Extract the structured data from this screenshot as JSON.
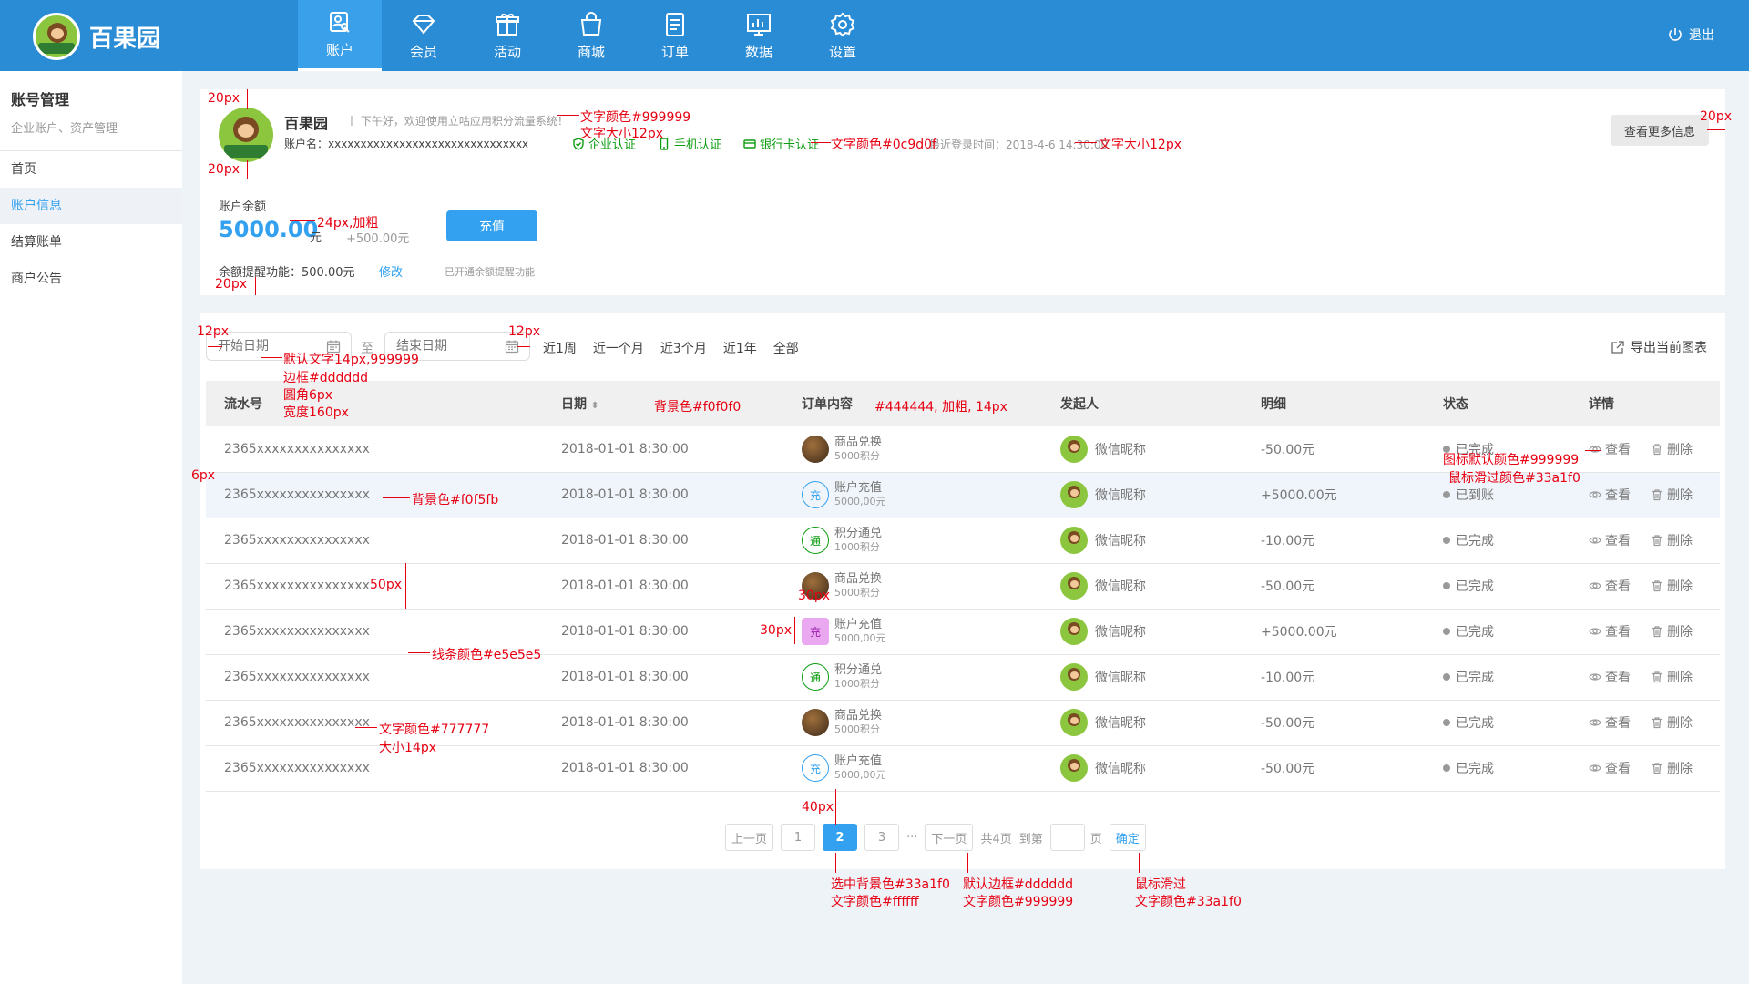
{
  "app": {
    "name": "百果园"
  },
  "nav": [
    {
      "label": "账户",
      "icon": "account-icon"
    },
    {
      "label": "会员",
      "icon": "diamond-icon"
    },
    {
      "label": "活动",
      "icon": "gift-icon"
    },
    {
      "label": "商城",
      "icon": "bag-icon"
    },
    {
      "label": "订单",
      "icon": "order-icon"
    },
    {
      "label": "数据",
      "icon": "chart-icon"
    },
    {
      "label": "设置",
      "icon": "gear-icon"
    }
  ],
  "logout": "退出",
  "sidebar": {
    "title": "账号管理",
    "subtitle": "企业账户、资产管理",
    "items": [
      {
        "label": "首页"
      },
      {
        "label": "账户信息",
        "active": true
      },
      {
        "label": "结算账单"
      },
      {
        "label": "商户公告"
      }
    ]
  },
  "account": {
    "name": "百果园",
    "greeting": "丨 下午好，欢迎使用立咕应用积分流量系统！",
    "account_label": "账户名：xxxxxxxxxxxxxxxxxxxxxxxxxxxxxxx",
    "certs": [
      "企业认证",
      "手机认证",
      "银行卡认证"
    ],
    "last_login": "最近登录时间：2018-4-6 14:30:00",
    "more_button": "查看更多信息",
    "balance_label": "账户余额",
    "balance": "5000.00",
    "balance_unit": "元",
    "balance_extra": "+500.00元",
    "recharge_button": "充值",
    "remind": "余额提醒功能：500.00元",
    "modify": "修改",
    "remind_note": "已开通余额提醒功能"
  },
  "filter": {
    "start_placeholder": "开始日期",
    "end_placeholder": "结束日期",
    "to": "至",
    "ranges": [
      "近1周",
      "近一个月",
      "近3个月",
      "近1年",
      "全部"
    ],
    "export": "导出当前图表"
  },
  "table": {
    "headers": [
      "流水号",
      "日期",
      "订单内容",
      "发起人",
      "明细",
      "状态",
      "详情"
    ],
    "rows": [
      {
        "serial": "2365xxxxxxxxxxxxxxx",
        "date": "2018-01-01 8:30:00",
        "icon": "img",
        "icon_text": "",
        "title": "商品兑换",
        "sub": "5000积分",
        "user": "微信昵称",
        "amount": "-50.00元",
        "status": "已完成"
      },
      {
        "serial": "2365xxxxxxxxxxxxxxx",
        "date": "2018-01-01 8:30:00",
        "icon": "blue",
        "icon_text": "充",
        "title": "账户充值",
        "sub": "5000,00元",
        "user": "微信昵称",
        "amount": "+5000.00元",
        "status": "已到账"
      },
      {
        "serial": "2365xxxxxxxxxxxxxxx",
        "date": "2018-01-01 8:30:00",
        "icon": "green",
        "icon_text": "通",
        "title": "积分通兑",
        "sub": "1000积分",
        "user": "微信昵称",
        "amount": "-10.00元",
        "status": "已完成"
      },
      {
        "serial": "2365xxxxxxxxxxxxxxx",
        "date": "2018-01-01 8:30:00",
        "icon": "img",
        "icon_text": "",
        "title": "商品兑换",
        "sub": "5000积分",
        "user": "微信昵称",
        "amount": "-50.00元",
        "status": "已完成"
      },
      {
        "serial": "2365xxxxxxxxxxxxxxx",
        "date": "2018-01-01 8:30:00",
        "icon": "pink",
        "icon_text": "充",
        "title": "账户充值",
        "sub": "5000,00元",
        "user": "微信昵称",
        "amount": "+5000.00元",
        "status": "已完成"
      },
      {
        "serial": "2365xxxxxxxxxxxxxxx",
        "date": "2018-01-01 8:30:00",
        "icon": "green",
        "icon_text": "通",
        "title": "积分通兑",
        "sub": "1000积分",
        "user": "微信昵称",
        "amount": "-10.00元",
        "status": "已完成"
      },
      {
        "serial": "2365xxxxxxxxxxxxxxx",
        "date": "2018-01-01 8:30:00",
        "icon": "img",
        "icon_text": "",
        "title": "商品兑换",
        "sub": "5000积分",
        "user": "微信昵称",
        "amount": "-50.00元",
        "status": "已完成"
      },
      {
        "serial": "2365xxxxxxxxxxxxxxx",
        "date": "2018-01-01 8:30:00",
        "icon": "blue",
        "icon_text": "充",
        "title": "账户充值",
        "sub": "5000,00元",
        "user": "微信昵称",
        "amount": "-50.00元",
        "status": "已完成"
      }
    ],
    "view": "查看",
    "delete": "删除"
  },
  "pager": {
    "prev": "上一页",
    "pages": [
      "1",
      "2",
      "3"
    ],
    "current": "2",
    "ellipsis": "···",
    "next": "下一页",
    "total": "共4页",
    "goto": "到第",
    "page_unit": "页",
    "confirm": "确定"
  },
  "annotations": [
    "20px",
    "20px",
    "文字颜色#999999",
    "文字大小12px",
    "文字颜色#0c9d0f",
    "文字大小12px",
    "20px",
    "24px,加粗",
    "20px",
    "12px",
    "12px",
    "默认文字14px,999999",
    "边框#dddddd",
    "圆角6px",
    "宽度160px",
    "背景色#f0f0f0",
    "#444444, 加粗, 14px",
    "6px",
    "背景色#f0f5fb",
    "50px",
    "30px",
    "30px",
    "线条颜色#e5e5e5",
    "文字颜色#777777",
    "大小14px",
    "图标默认颜色#999999",
    "鼠标滑过颜色#33a1f0",
    "40px",
    "选中背景色#33a1f0",
    "文字颜色#ffffff",
    "默认边框#dddddd",
    "文字颜色#999999",
    "鼠标滑过",
    "文字颜色#33a1f0"
  ],
  "colors": {
    "brand": "#2b8cd6",
    "accent": "#33a1f0",
    "success": "#0c9d0f",
    "annotation": "#e60012"
  }
}
